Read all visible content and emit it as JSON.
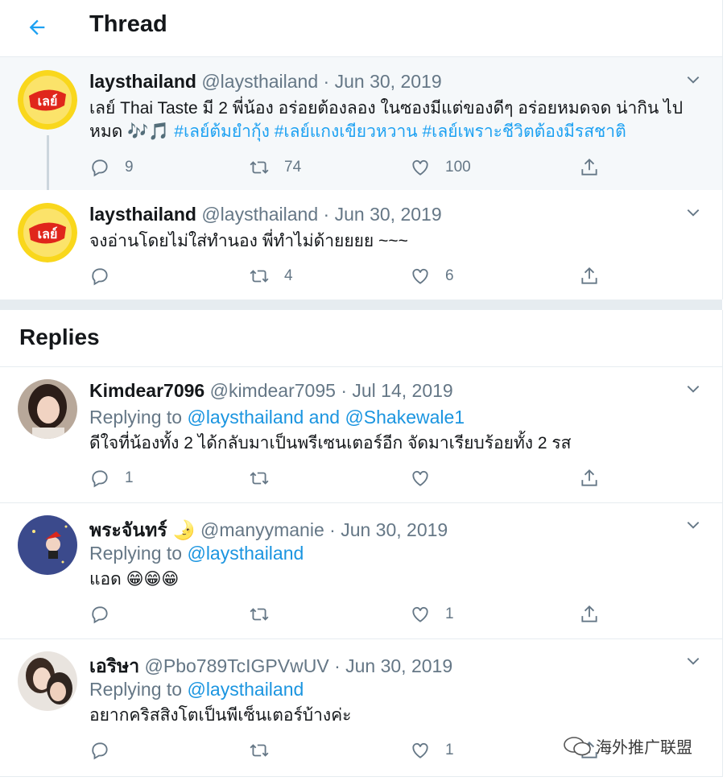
{
  "header": {
    "title": "Thread"
  },
  "thread": [
    {
      "name": "laysthailand",
      "handle": "@laysthailand",
      "sep": "·",
      "date": "Jun 30, 2019",
      "text_plain": "เลย์ Thai Taste มี 2 พี่น้อง อร่อยต้องลอง ในซองมีแต่ของดีๆ อร่อยหมดจด น่ากิน ไปหมด ",
      "emoji": "🎶🎵",
      "hashtags": " #เลย์ต้มยำกุ้ง #เลย์แกงเขียวหวาน #เลย์เพราะชีวิตต้องมีรสชาติ",
      "replies": "9",
      "retweets": "74",
      "likes": "100",
      "avatar_text": "เลย์"
    },
    {
      "name": "laysthailand",
      "handle": "@laysthailand",
      "sep": "·",
      "date": "Jun 30, 2019",
      "text": "จงอ่านโดยไม่ใส่ทำนอง พี่ทำไม่ด้ายยยย ~~~",
      "replies": "",
      "retweets": "4",
      "likes": "6",
      "avatar_text": "เลย์"
    }
  ],
  "replies_heading": "Replies",
  "replies": [
    {
      "name": "Kimdear7096",
      "handle": "@kimdear7095",
      "sep": "·",
      "date": "Jul 14, 2019",
      "replying_prefix": "Replying to ",
      "replying_to": "@laysthailand and @Shakewale1",
      "text": "ดีใจที่น้องทั้ง 2 ได้กลับมาเป็นพรีเซนเตอร์อีก จัดมาเรียบร้อยทั้ง 2 รส",
      "replies": "1",
      "retweets": "",
      "likes": ""
    },
    {
      "name": "พระจันทร์ 🌛",
      "handle": "@manyymanie",
      "sep": "·",
      "date": "Jun 30, 2019",
      "replying_prefix": "Replying to ",
      "replying_to": "@laysthailand",
      "text": "แอด 😁😁😁",
      "replies": "",
      "retweets": "",
      "likes": "1"
    },
    {
      "name": "เอริษา",
      "handle": "@Pbo789TcIGPVwUV",
      "sep": "·",
      "date": "Jun 30, 2019",
      "replying_prefix": "Replying to ",
      "replying_to": "@laysthailand",
      "text": "อยากคริสสิงโตเป็นพีเซ็นเตอร์บ้างค่ะ",
      "replies": "",
      "retweets": "",
      "likes": "1"
    }
  ],
  "watermark": "海外推广联盟",
  "colors": {
    "accent": "#1da1f2",
    "secondary_text": "#657786",
    "divider": "#e6ecf0",
    "highlight_bg": "#f5f8fa"
  }
}
